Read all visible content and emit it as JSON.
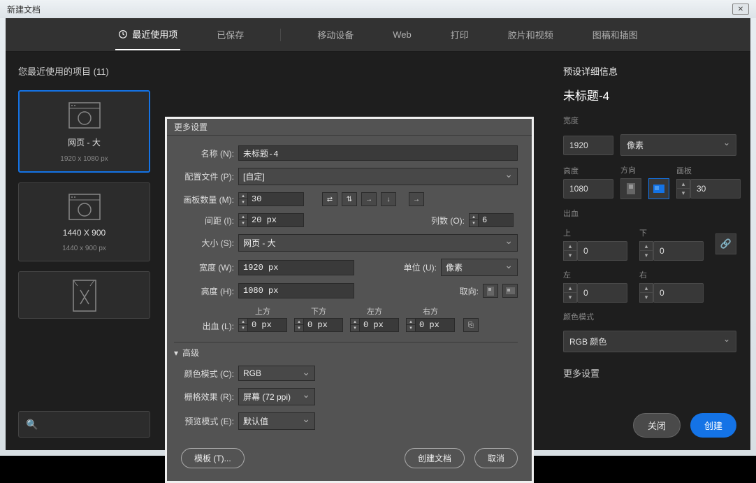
{
  "window": {
    "title": "新建文档"
  },
  "tabs": {
    "recent": "最近使用项",
    "saved": "已保存",
    "mobile": "移动设备",
    "web": "Web",
    "print": "打印",
    "film": "胶片和视频",
    "art": "图稿和插图"
  },
  "left": {
    "title": "您最近使用的项目  (11)",
    "presets": [
      {
        "name": "网页 - 大",
        "dim": "1920 x 1080 px"
      },
      {
        "name": "1440 X 900",
        "dim": "1440 x 900 px"
      },
      {
        "name": "",
        "dim": ""
      }
    ]
  },
  "dialog": {
    "title": "更多设置",
    "name_label": "名称 (N):",
    "name_value": "未标题-4",
    "profile_label": "配置文件 (P):",
    "profile_value": "[自定]",
    "artboards_label": "画板数量 (M):",
    "artboards_value": "30",
    "spacing_label": "间距 (I):",
    "spacing_value": "20 px",
    "cols_label": "列数 (O):",
    "cols_value": "6",
    "size_label": "大小 (S):",
    "size_value": "网页 - 大",
    "width_label": "宽度 (W):",
    "width_value": "1920 px",
    "unit_label": "单位 (U):",
    "unit_value": "像素",
    "height_label": "高度 (H):",
    "height_value": "1080 px",
    "orient_label": "取向:",
    "bleed_label": "出血 (L):",
    "bleed": {
      "top": "上方",
      "bottom": "下方",
      "left": "左方",
      "right": "右方",
      "value": "0 px"
    },
    "adv": "高级",
    "colormode_label": "颜色模式 (C):",
    "colormode_value": "RGB",
    "raster_label": "栅格效果 (R):",
    "raster_value": "屏幕 (72 ppi)",
    "preview_label": "预览模式 (E):",
    "preview_value": "默认值",
    "templates_btn": "模板 (T)...",
    "create_btn": "创建文档",
    "cancel_btn": "取消"
  },
  "right": {
    "heading": "预设详细信息",
    "title": "未标题-4",
    "width_label": "宽度",
    "width_value": "1920",
    "unit_value": "像素",
    "height_label": "高度",
    "height_value": "1080",
    "orient_label": "方向",
    "artboards_label": "画板",
    "artboards_value": "30",
    "bleed_label": "出血",
    "top": "上",
    "bottom": "下",
    "left": "左",
    "right": "右",
    "bleed_value": "0",
    "colormode_label": "颜色模式",
    "colormode_value": "RGB 颜色",
    "more": "更多设置",
    "close_btn": "关闭",
    "create_btn": "创建"
  }
}
